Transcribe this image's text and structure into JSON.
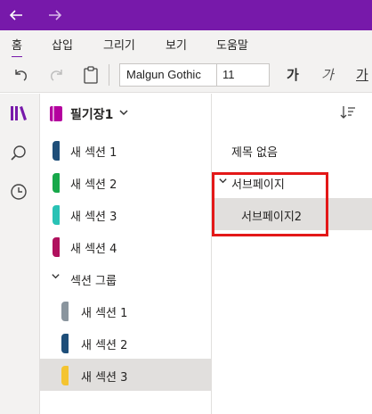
{
  "titlebar": {
    "back_icon": "back-arrow-icon",
    "forward_icon": "forward-arrow-icon",
    "color": "#7719aa"
  },
  "ribbon_tabs": [
    {
      "label": "홈",
      "active": true
    },
    {
      "label": "삽입"
    },
    {
      "label": "그리기"
    },
    {
      "label": "보기"
    },
    {
      "label": "도움말"
    }
  ],
  "toolbar": {
    "undo_icon": "undo-icon",
    "redo_icon": "redo-icon",
    "clipboard_icon": "clipboard-icon",
    "font_name": "Malgun Gothic",
    "font_size": "11",
    "bold_label": "가",
    "italic_label": "가",
    "underline_label": "가"
  },
  "rail": {
    "notebooks_icon": "notebooks-icon",
    "search_icon": "search-icon",
    "recent_icon": "clock-icon"
  },
  "notebook": {
    "title": "필기장1",
    "color": "#b4009e"
  },
  "sections": [
    {
      "label": "새 섹션 1",
      "color": "#1e4e79"
    },
    {
      "label": "새 섹션 2",
      "color": "#17a84a"
    },
    {
      "label": "새 섹션 3",
      "color": "#29c2b5"
    },
    {
      "label": "새 섹션 4",
      "color": "#b0115e"
    }
  ],
  "section_group": {
    "label": "섹션 그룹",
    "sections": [
      {
        "label": "새 섹션 1",
        "color": "#8a959e"
      },
      {
        "label": "새 섹션 2",
        "color": "#1e4e79"
      },
      {
        "label": "새 섹션 3",
        "color": "#f4c430",
        "selected": true
      }
    ]
  },
  "pages": [
    {
      "label": "제목 없음"
    },
    {
      "label": "서브페이지",
      "expanded": true
    },
    {
      "label": "서브페이지2",
      "selected": true,
      "subpage": true
    }
  ],
  "highlight_color": "#e31818"
}
